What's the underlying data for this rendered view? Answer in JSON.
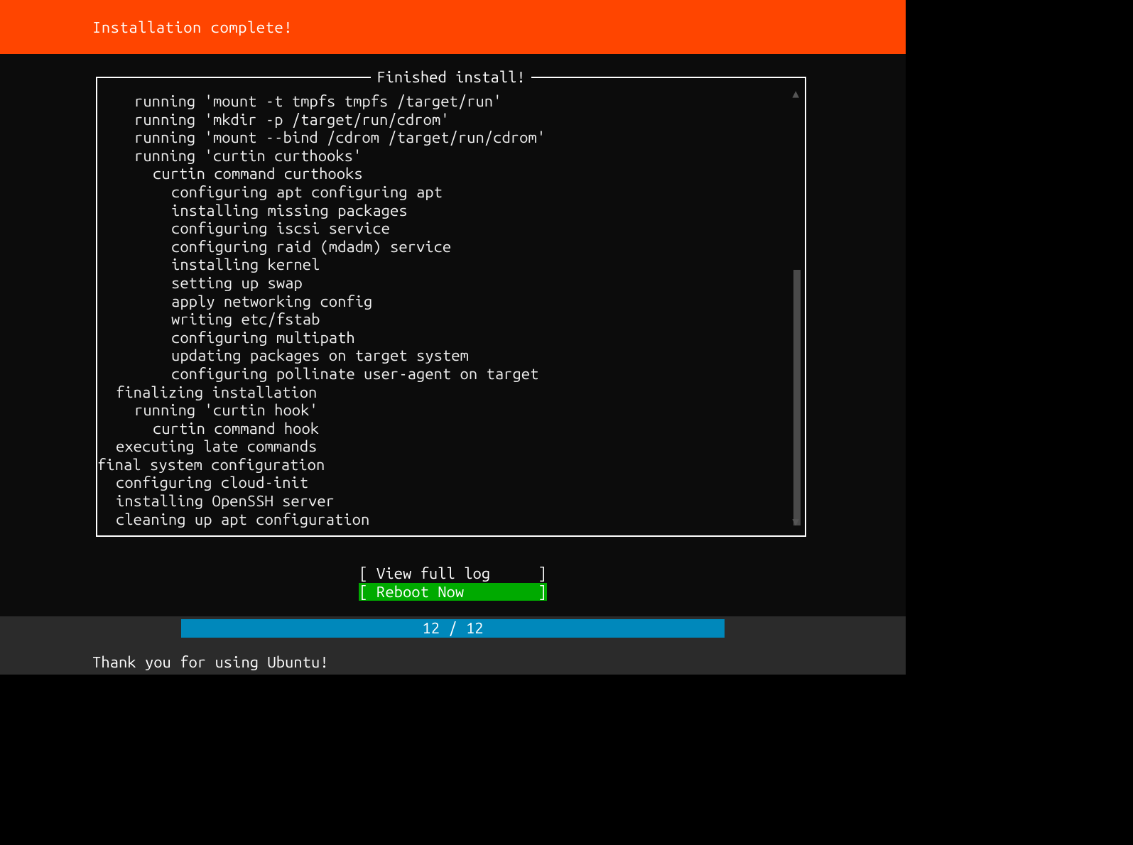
{
  "header": {
    "title": "Installation complete!"
  },
  "panel": {
    "title": "Finished install!"
  },
  "log_lines": [
    {
      "indent": "i1",
      "text": "running 'mount -t tmpfs tmpfs /target/run'"
    },
    {
      "indent": "i1",
      "text": "running 'mkdir -p /target/run/cdrom'"
    },
    {
      "indent": "i1",
      "text": "running 'mount --bind /cdrom /target/run/cdrom'"
    },
    {
      "indent": "i1",
      "text": "running 'curtin curthooks'"
    },
    {
      "indent": "i2",
      "text": "curtin command curthooks"
    },
    {
      "indent": "i3",
      "text": "configuring apt configuring apt"
    },
    {
      "indent": "i3",
      "text": "installing missing packages"
    },
    {
      "indent": "i3",
      "text": "configuring iscsi service"
    },
    {
      "indent": "i3",
      "text": "configuring raid (mdadm) service"
    },
    {
      "indent": "i3",
      "text": "installing kernel"
    },
    {
      "indent": "i3",
      "text": "setting up swap"
    },
    {
      "indent": "i3",
      "text": "apply networking config"
    },
    {
      "indent": "i3",
      "text": "writing etc/fstab"
    },
    {
      "indent": "i3",
      "text": "configuring multipath"
    },
    {
      "indent": "i3",
      "text": "updating packages on target system"
    },
    {
      "indent": "i3",
      "text": "configuring pollinate user-agent on target"
    },
    {
      "indent": "i4",
      "text": "finalizing installation"
    },
    {
      "indent": "i1",
      "text": "running 'curtin hook'"
    },
    {
      "indent": "i2",
      "text": "curtin command hook"
    },
    {
      "indent": "i4",
      "text": "executing late commands"
    },
    {
      "indent": "i0",
      "text": "final system configuration"
    },
    {
      "indent": "i4",
      "text": "configuring cloud-init"
    },
    {
      "indent": "i4",
      "text": "installing OpenSSH server"
    },
    {
      "indent": "i4",
      "text": "cleaning up apt configuration"
    }
  ],
  "buttons": {
    "view_log": "View full log",
    "reboot": "Reboot Now"
  },
  "progress": {
    "text": "12 / 12"
  },
  "footer": {
    "thankyou": "Thank you for using Ubuntu!"
  }
}
